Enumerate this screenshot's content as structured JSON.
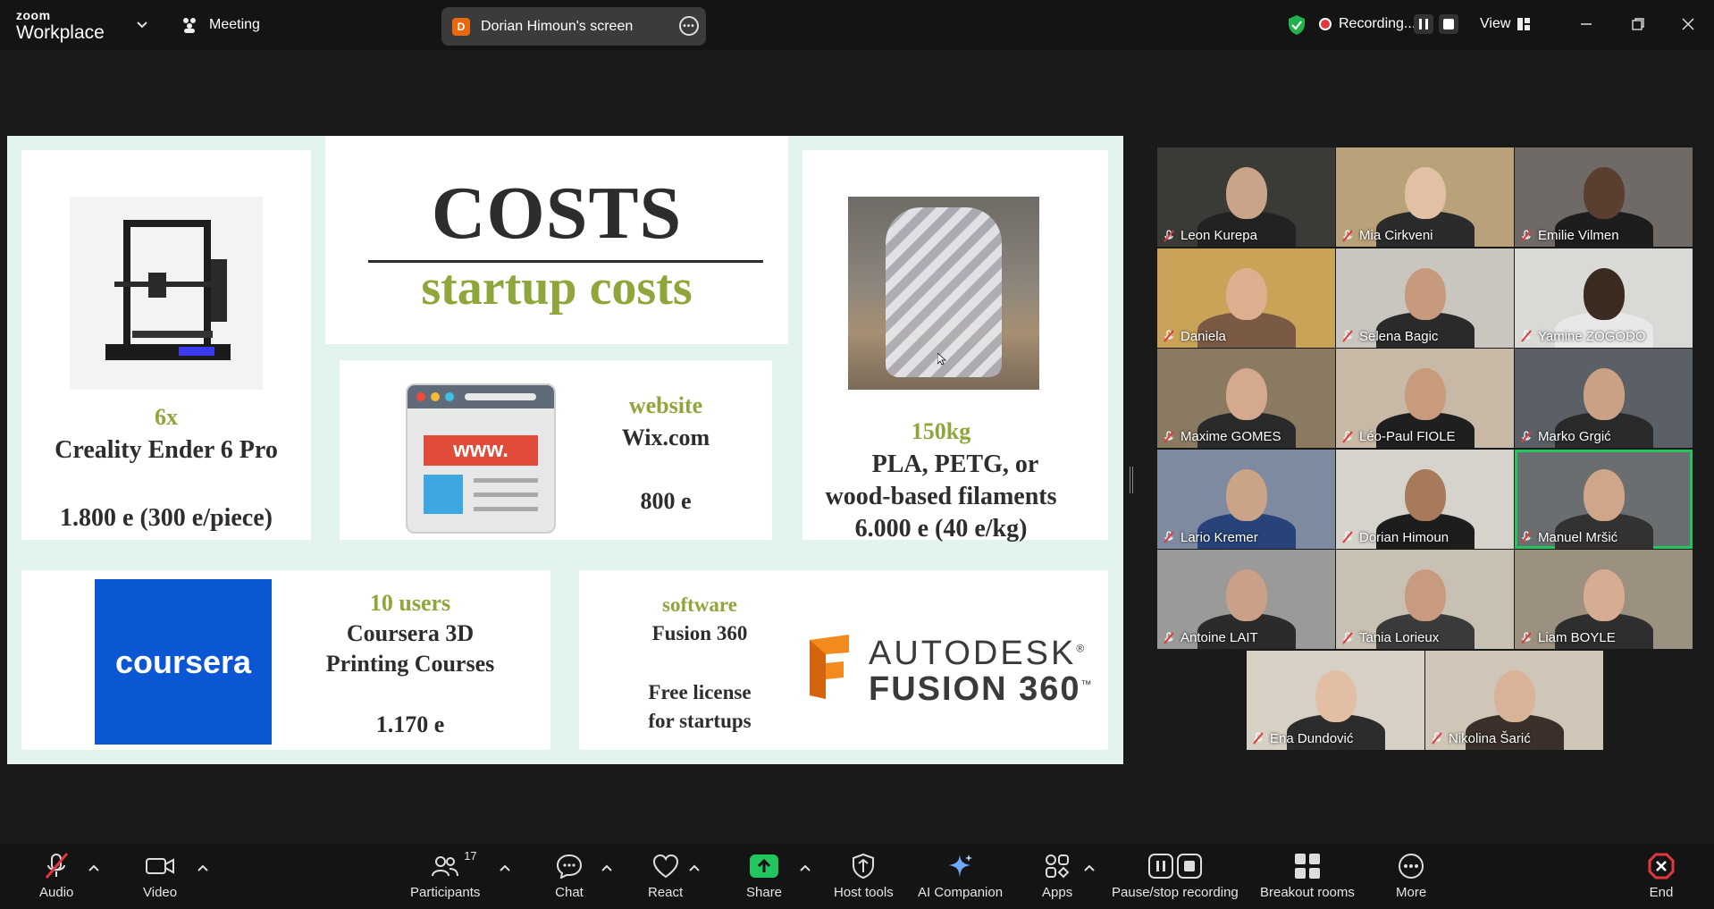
{
  "app": {
    "brand_top": "zoom",
    "brand_bottom": "Workplace",
    "meeting_label": "Meeting"
  },
  "share_pill": {
    "avatar_letter": "D",
    "label": "Dorian Himoun's screen"
  },
  "recording": {
    "label": "Recording..."
  },
  "view_label": "View",
  "slide": {
    "title": "COSTS",
    "subtitle": "startup costs",
    "printer": {
      "qty": "6x",
      "name": "Creality Ender 6 Pro",
      "price": "1.800 e (300 e/piece)"
    },
    "website": {
      "heading": "website",
      "name": "Wix.com",
      "price": "800 e",
      "icon_text": "www."
    },
    "filament": {
      "weight": "150kg",
      "line1": "PLA, PETG, or",
      "line2": "wood-based filaments",
      "price": "6.000 e (40 e/kg)"
    },
    "courses": {
      "heading": "10 users",
      "line1": "Coursera 3D",
      "line2": "Printing Courses",
      "price": "1.170 e",
      "logo_text": "coursera"
    },
    "software": {
      "heading": "software",
      "name": "Fusion 360",
      "line1": "Free license",
      "line2": "for startups",
      "logo_line1": "AUTODESK",
      "logo_line2": "FUSION 360",
      "trademark": "®",
      "tm": "™"
    }
  },
  "participants": [
    {
      "name": "Leon Kurepa",
      "bg": "#3a3a36",
      "skin": "#c9a488",
      "shirt": "#222"
    },
    {
      "name": "Mia Cirkveni",
      "bg": "#b9a27a",
      "skin": "#e2c0a4",
      "shirt": "#2b2b2b"
    },
    {
      "name": "Emilie Vilmen",
      "bg": "#6f6a66",
      "skin": "#5a3e30",
      "shirt": "#1d1d1d"
    },
    {
      "name": "Daniela",
      "bg": "#c9a458",
      "skin": "#dcb08e",
      "shirt": "#7a5a44"
    },
    {
      "name": "Selena Bagic",
      "bg": "#c9c6c0",
      "skin": "#c79a7e",
      "shirt": "#2a2a2a"
    },
    {
      "name": "Yamine ZOGODO",
      "bg": "#d9d9d6",
      "skin": "#3a2a20",
      "shirt": "#e8e8e8"
    },
    {
      "name": "Maxime GOMES",
      "bg": "#8a7a62",
      "skin": "#d4a98e",
      "shirt": "#2a2a2a"
    },
    {
      "name": "Léo-Paul FIOLE",
      "bg": "#c7b9a6",
      "skin": "#c99b7d",
      "shirt": "#1f1f1f"
    },
    {
      "name": "Marko Grgić",
      "bg": "#5b6067",
      "skin": "#caa184",
      "shirt": "#2a2a2a"
    },
    {
      "name": "Lario Kremer",
      "bg": "#7d8aa0",
      "skin": "#cba488",
      "shirt": "#27437a"
    },
    {
      "name": "Dorian Himoun",
      "bg": "#d6d2cc",
      "skin": "#a77a5c",
      "shirt": "#1d1d1d"
    },
    {
      "name": "Manuel Mršić",
      "bg": "#6b6e70",
      "skin": "#d0a68a",
      "shirt": "#323232"
    },
    {
      "name": "Antoine LAIT",
      "bg": "#9a9a98",
      "skin": "#caa088",
      "shirt": "#2b2b2b"
    },
    {
      "name": "Tania Lorieux",
      "bg": "#c8c0b2",
      "skin": "#c89b80",
      "shirt": "#3a3a3a"
    },
    {
      "name": "Liam BOYLE",
      "bg": "#9c9080",
      "skin": "#d6ad92",
      "shirt": "#2e2e2e"
    },
    {
      "name": "Ena Dundović",
      "bg": "#d7d0c5",
      "skin": "#e1bea4",
      "shirt": "#2c2c2c"
    },
    {
      "name": "Nikolina Šarić",
      "bg": "#cfc6b8",
      "skin": "#d8b398",
      "shirt": "#3b2f2a"
    }
  ],
  "toolbar": {
    "audio": "Audio",
    "video": "Video",
    "participants": "Participants",
    "participants_count": "17",
    "chat": "Chat",
    "react": "React",
    "share": "Share",
    "host_tools": "Host tools",
    "ai_companion": "AI Companion",
    "apps": "Apps",
    "pause_stop": "Pause/stop recording",
    "breakout": "Breakout rooms",
    "more": "More",
    "end": "End"
  },
  "colors": {
    "olive": "#8ea63a",
    "coursera_blue": "#0a56d3",
    "share_green": "#22c55e",
    "end_red": "#e0383e"
  }
}
